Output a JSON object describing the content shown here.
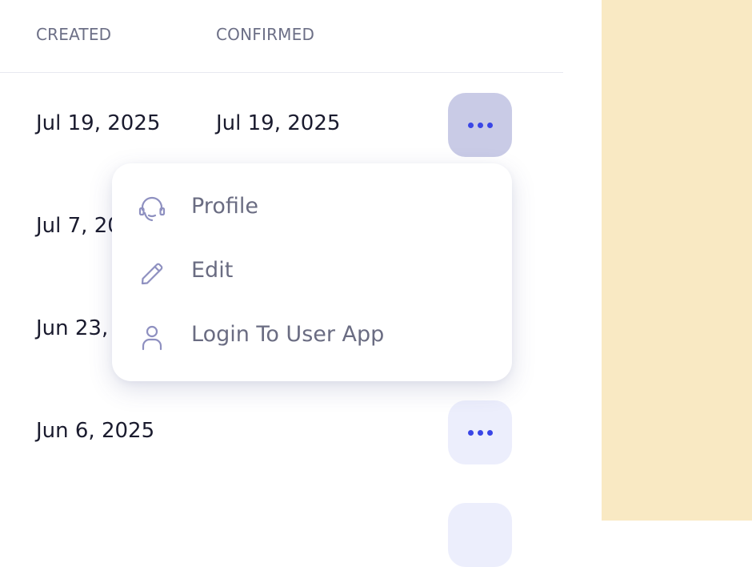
{
  "table": {
    "columns": {
      "created": "CREATED",
      "confirmed": "CONFIRMED"
    },
    "rows": [
      {
        "created": "Jul 19, 2025",
        "confirmed": "Jul 19, 2025"
      },
      {
        "created": "Jul 7, 20",
        "confirmed": ""
      },
      {
        "created": "Jun 23,",
        "confirmed": ""
      },
      {
        "created": "Jun 6, 2025",
        "confirmed": ""
      }
    ]
  },
  "row_menu": {
    "items": [
      {
        "label": "Profile",
        "icon": "headset-icon"
      },
      {
        "label": "Edit",
        "icon": "pencil-icon"
      },
      {
        "label": "Login To User App",
        "icon": "user-icon"
      }
    ]
  },
  "colors": {
    "accent": "#3a46e6",
    "button_bg": "#eceefc",
    "button_active_bg": "#c9cbe6",
    "side_panel": "#f9e9c3"
  }
}
